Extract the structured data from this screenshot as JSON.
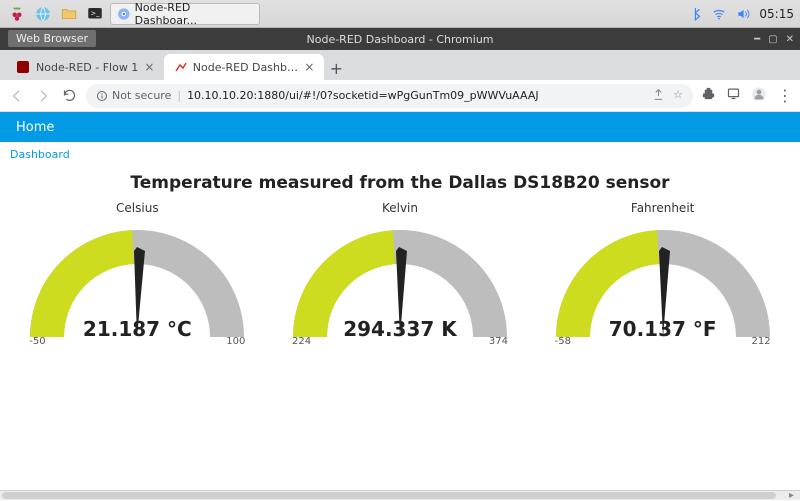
{
  "os": {
    "tooltip": "Web Browser",
    "task_label": "Node-RED Dashboar...",
    "clock": "05:15"
  },
  "window": {
    "title": "Node-RED Dashboard - Chromium"
  },
  "tabs": {
    "t0": {
      "label": "Node-RED - Flow 1"
    },
    "t1": {
      "label": "Node-RED Dashboard"
    }
  },
  "toolbar": {
    "secure_label": "Not secure",
    "url": "10.10.10.20:1880/ui/#!/0?socketid=wPgGunTm09_pWWVuAAAJ"
  },
  "page": {
    "topbar_home": "Home",
    "breadcrumb": "Dashboard",
    "title": "Temperature measured from the Dallas DS18B20 sensor"
  },
  "gauges": {
    "celsius": {
      "label": "Celsius",
      "value_text": "21.187 °C",
      "min": "-50",
      "max": "100"
    },
    "kelvin": {
      "label": "Kelvin",
      "value_text": "294.337 K",
      "min": "224",
      "max": "374"
    },
    "fahrenheit": {
      "label": "Fahrenheit",
      "value_text": "70.137 °F",
      "min": "-58",
      "max": "212"
    }
  },
  "chart_data": [
    {
      "type": "gauge",
      "title": "Celsius",
      "value": 21.187,
      "unit": "°C",
      "min": -50,
      "max": 100
    },
    {
      "type": "gauge",
      "title": "Kelvin",
      "value": 294.337,
      "unit": "K",
      "min": 224,
      "max": 374
    },
    {
      "type": "gauge",
      "title": "Fahrenheit",
      "value": 70.137,
      "unit": "°F",
      "min": -58,
      "max": 212
    }
  ],
  "colors": {
    "accent": "#039be5",
    "gauge_fill": "#cddc1e",
    "gauge_track": "#bdbdbd",
    "needle": "#222222"
  }
}
